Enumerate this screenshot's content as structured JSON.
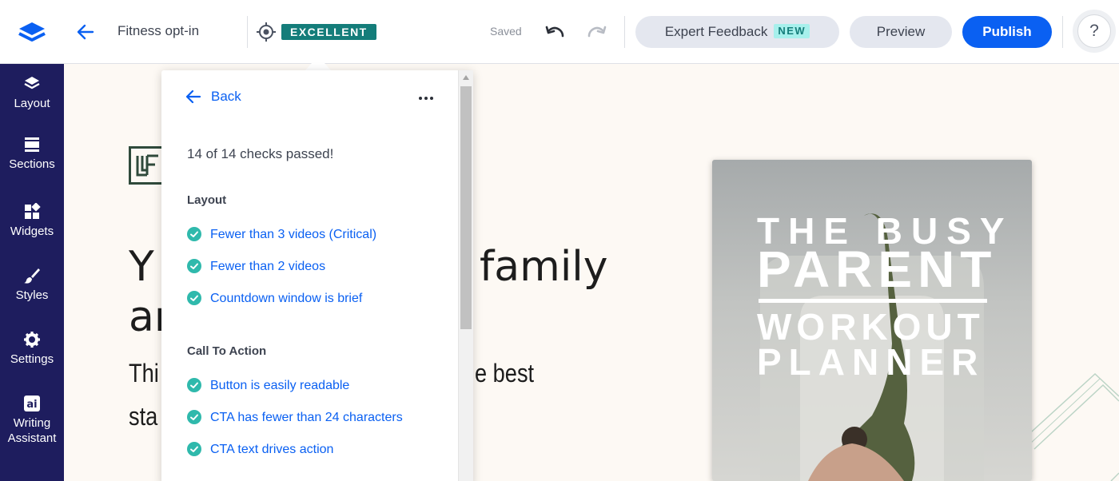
{
  "topbar": {
    "page_name": "Fitness opt-in",
    "score": "EXCELLENT",
    "saved_status": "Saved",
    "expert_feedback_label": "Expert Feedback",
    "new_badge": "NEW",
    "preview_label": "Preview",
    "publish_label": "Publish",
    "help_label": "?"
  },
  "sidebar": {
    "items": [
      {
        "label": "Layout",
        "icon": "layers-icon"
      },
      {
        "label": "Sections",
        "icon": "sections-icon"
      },
      {
        "label": "Widgets",
        "icon": "widgets-icon"
      },
      {
        "label": "Styles",
        "icon": "brush-icon"
      },
      {
        "label": "Settings",
        "icon": "gear-icon"
      },
      {
        "label": "Writing",
        "label2": "Assistant",
        "icon": "ai-icon"
      }
    ]
  },
  "popover": {
    "back_label": "Back",
    "summary": "14 of 14 checks passed!",
    "sections": [
      {
        "title": "Layout",
        "checks": [
          "Fewer than 3 videos (Critical)",
          "Fewer than 2 videos",
          "Countdown window is brief"
        ]
      },
      {
        "title": "Call To Action",
        "checks": [
          "Button is easily readable",
          "CTA has fewer than 24 characters",
          "CTA text drives action"
        ]
      }
    ]
  },
  "canvas": {
    "headline_line1_start": "Y",
    "headline_line1_end": "family",
    "headline_line2_start": "ar",
    "subhead_line1_start": "Thi",
    "subhead_line1_end": "e best",
    "subhead_line2_start": "sta",
    "book": {
      "line1": "THE BUSY",
      "line2": "PARENT",
      "line3": "WORKOUT",
      "line4": "PLANNER"
    }
  },
  "colors": {
    "primary": "#0a60f2",
    "sidebar": "#1e1d5e",
    "score_badge": "#147d7a",
    "check": "#2fb9ac",
    "canvas_bg": "#fdf9f4"
  }
}
